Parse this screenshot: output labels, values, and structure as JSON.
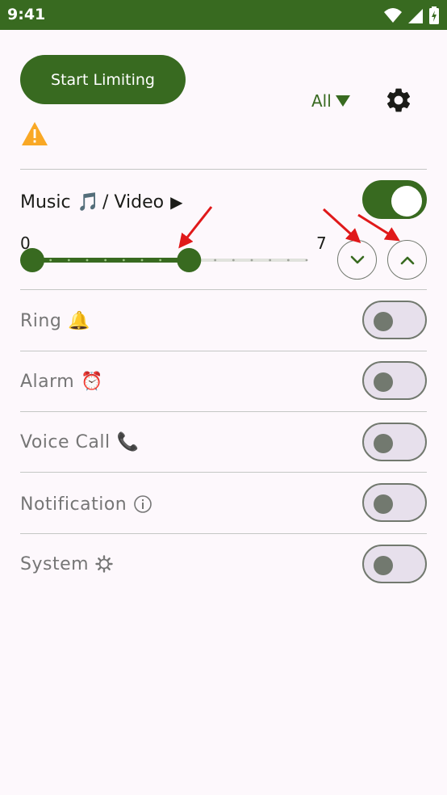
{
  "status_bar": {
    "time": "9:41"
  },
  "header": {
    "start_button_label": "Start Limiting",
    "filter_label": "All"
  },
  "music": {
    "label": "Music",
    "separator": " / Video",
    "slider_min_label": "0",
    "slider_max_label": "7",
    "slider_value": 4,
    "slider_max": 7,
    "enabled": true
  },
  "streams": [
    {
      "label": "Ring",
      "icon": "bell-icon",
      "enabled": false
    },
    {
      "label": "Alarm",
      "icon": "alarm-clock-icon",
      "enabled": false
    },
    {
      "label": "Voice Call",
      "icon": "phone-icon",
      "enabled": false
    },
    {
      "label": "Notification",
      "icon": "info-icon",
      "enabled": false
    },
    {
      "label": "System",
      "icon": "gear-icon",
      "enabled": false
    }
  ],
  "colors": {
    "primary": "#386a20",
    "track_inactive": "#e1e3dd",
    "toggle_off_bg": "#e7e0ec",
    "toggle_off_outline": "#72796f",
    "warning": "#f9a825",
    "annotation_arrow": "#e0191a"
  }
}
